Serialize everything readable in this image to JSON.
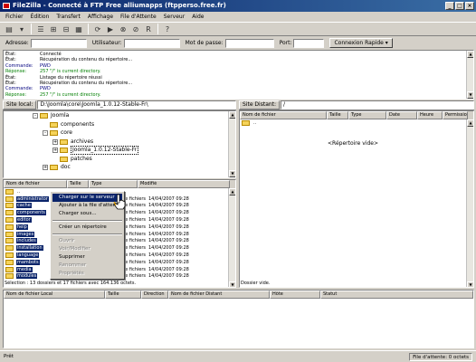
{
  "window": {
    "title": "FileZilla - Connecté à FTP Free alliumapps (ftpperso.free.fr)"
  },
  "menubar": [
    "Fichier",
    "Édition",
    "Transfert",
    "Affichage",
    "File d'Attente",
    "Serveur",
    "Aide"
  ],
  "quickconnect": {
    "host_label": "Adresse:",
    "user_label": "Utilisateur:",
    "pass_label": "Mot de passe:",
    "port_label": "Port:",
    "button_label": "Connexion Rapide"
  },
  "log": [
    {
      "type": "État:",
      "msg": "Connecté"
    },
    {
      "type": "État:",
      "msg": "Récupération du contenu du répertoire..."
    },
    {
      "type": "Commande:",
      "msg": "PWD"
    },
    {
      "type": "Réponse:",
      "msg": "257 \"/\" is current directory."
    },
    {
      "type": "État:",
      "msg": "Listage du répertoire réussi"
    },
    {
      "type": "État:",
      "msg": "Récupération du contenu du répertoire..."
    },
    {
      "type": "Commande:",
      "msg": "PWD"
    },
    {
      "type": "Réponse:",
      "msg": "257 \"/\" is current directory."
    }
  ],
  "local": {
    "path_label": "Site local:",
    "path": "D:\\Joomla\\core\\Joomla_1.0.12-Stable-Fr\\",
    "tree": [
      {
        "label": "Joomla",
        "level": 0,
        "exp": "-"
      },
      {
        "label": "components",
        "level": 1,
        "exp": ""
      },
      {
        "label": "core",
        "level": 1,
        "exp": "-"
      },
      {
        "label": "archives",
        "level": 2,
        "exp": "+"
      },
      {
        "label": "Joomla_1.0.12-Stable-Fr",
        "level": 2,
        "exp": "+"
      },
      {
        "label": "patches",
        "level": 2,
        "exp": ""
      },
      {
        "label": "doc",
        "level": 1,
        "exp": "+"
      }
    ],
    "columns": [
      "Nom de fichier",
      "Taille",
      "Type",
      "Modifié"
    ],
    "files": [
      {
        "name": "..",
        "type": "",
        "date": "",
        "sel": false
      },
      {
        "name": "administrator",
        "type": "Dossier de fichiers",
        "date": "14/04/2007 09:28",
        "sel": true
      },
      {
        "name": "cache",
        "type": "Dossier de fichiers",
        "date": "14/04/2007 09:28",
        "sel": true
      },
      {
        "name": "components",
        "type": "Dossier de fichiers",
        "date": "14/04/2007 09:28",
        "sel": true
      },
      {
        "name": "editor",
        "type": "Dossier de fichiers",
        "date": "14/04/2007 09:28",
        "sel": true
      },
      {
        "name": "help",
        "type": "Dossier de fichiers",
        "date": "14/04/2007 09:28",
        "sel": true
      },
      {
        "name": "images",
        "type": "Dossier de fichiers",
        "date": "14/04/2007 09:28",
        "sel": true
      },
      {
        "name": "includes",
        "type": "Dossier de fichiers",
        "date": "14/04/2007 09:28",
        "sel": true
      },
      {
        "name": "installation",
        "type": "Dossier de fichiers",
        "date": "14/04/2007 09:28",
        "sel": true
      },
      {
        "name": "language",
        "type": "Dossier de fichiers",
        "date": "14/04/2007 09:28",
        "sel": true
      },
      {
        "name": "mambots",
        "type": "Dossier de fichiers",
        "date": "14/04/2007 09:28",
        "sel": true
      },
      {
        "name": "media",
        "type": "Dossier de fichiers",
        "date": "14/04/2007 09:28",
        "sel": true
      },
      {
        "name": "modules",
        "type": "Dossier de fichiers",
        "date": "14/04/2007 09:28",
        "sel": true
      }
    ],
    "status": "Sélection : 13 dossiers et 17 fichiers avec 164.136 octets."
  },
  "remote": {
    "path_label": "Site Distant:",
    "path": "/",
    "columns": [
      "Nom de fichier",
      "Taille",
      "Type",
      "Date",
      "Heure",
      "Permissions"
    ],
    "files": [
      {
        "name": ".."
      }
    ],
    "empty_msg": "<Répertoire vide>",
    "status": "Dossier vide."
  },
  "context_menu": [
    {
      "label": "Charger sur le serveur",
      "state": "hl"
    },
    {
      "label": "Ajouter à la file d'attente",
      "state": ""
    },
    {
      "label": "Charger sous...",
      "state": ""
    },
    {
      "label": "-",
      "state": "sep"
    },
    {
      "label": "Créer un répertoire",
      "state": ""
    },
    {
      "label": "-",
      "state": "sep"
    },
    {
      "label": "Ouvrir",
      "state": "dis"
    },
    {
      "label": "Voir/Modifier",
      "state": "dis"
    },
    {
      "label": "Supprimer",
      "state": ""
    },
    {
      "label": "Renommer",
      "state": "dis"
    },
    {
      "label": "Propriétés",
      "state": "dis"
    }
  ],
  "queue": {
    "columns": [
      "Nom de fichier Local",
      "Taille",
      "Direction",
      "Nom de fichier Distant",
      "Hôte",
      "Statut"
    ]
  },
  "statusbar": {
    "left": "Prêt",
    "right": "File d'attente: 0 octets"
  }
}
